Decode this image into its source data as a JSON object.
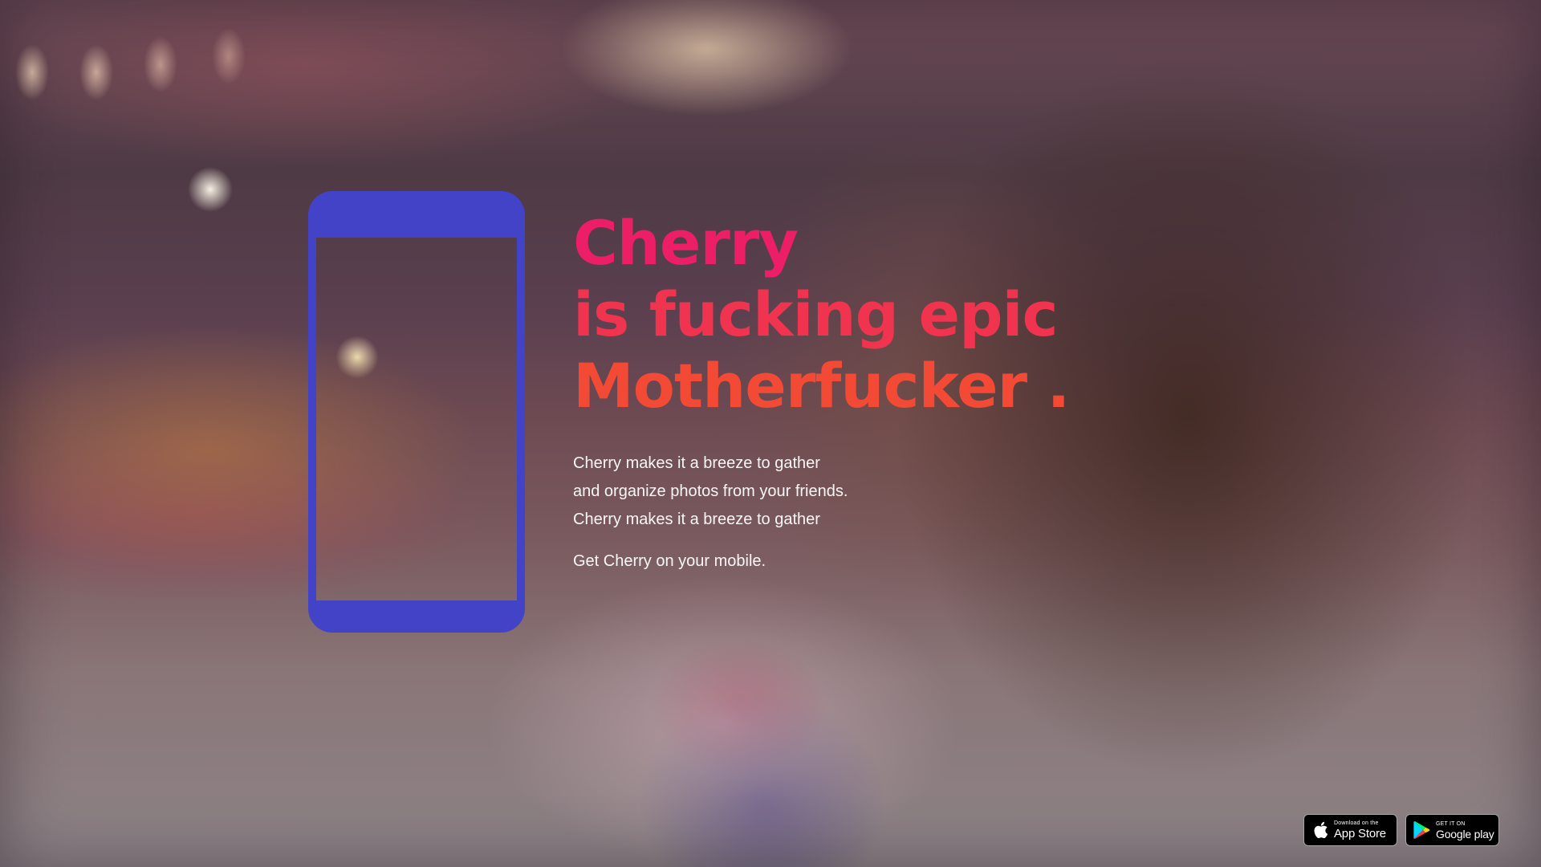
{
  "hero": {
    "headline_lines": [
      "Cherry",
      "is fucking epic",
      "Motherfucker ."
    ],
    "description_lines": [
      "Cherry makes it a breeze to gather",
      "and organize photos from your friends.",
      "Cherry makes it a breeze to gather"
    ],
    "cta_text": "Get Cherry on your mobile."
  },
  "badges": {
    "app_store": {
      "small_label": "Download on the",
      "large_label": "App Store",
      "icon": "apple-icon"
    },
    "google_play": {
      "small_label": "GET IT ON",
      "large_label": "Google play",
      "icon": "google-play-icon"
    }
  },
  "colors": {
    "headline_line_1": "#ec1e65",
    "headline_line_2": "#f0334e",
    "headline_line_3": "#f34a36",
    "phone_frame": "#4343c8",
    "body_text": "#ffffff"
  }
}
